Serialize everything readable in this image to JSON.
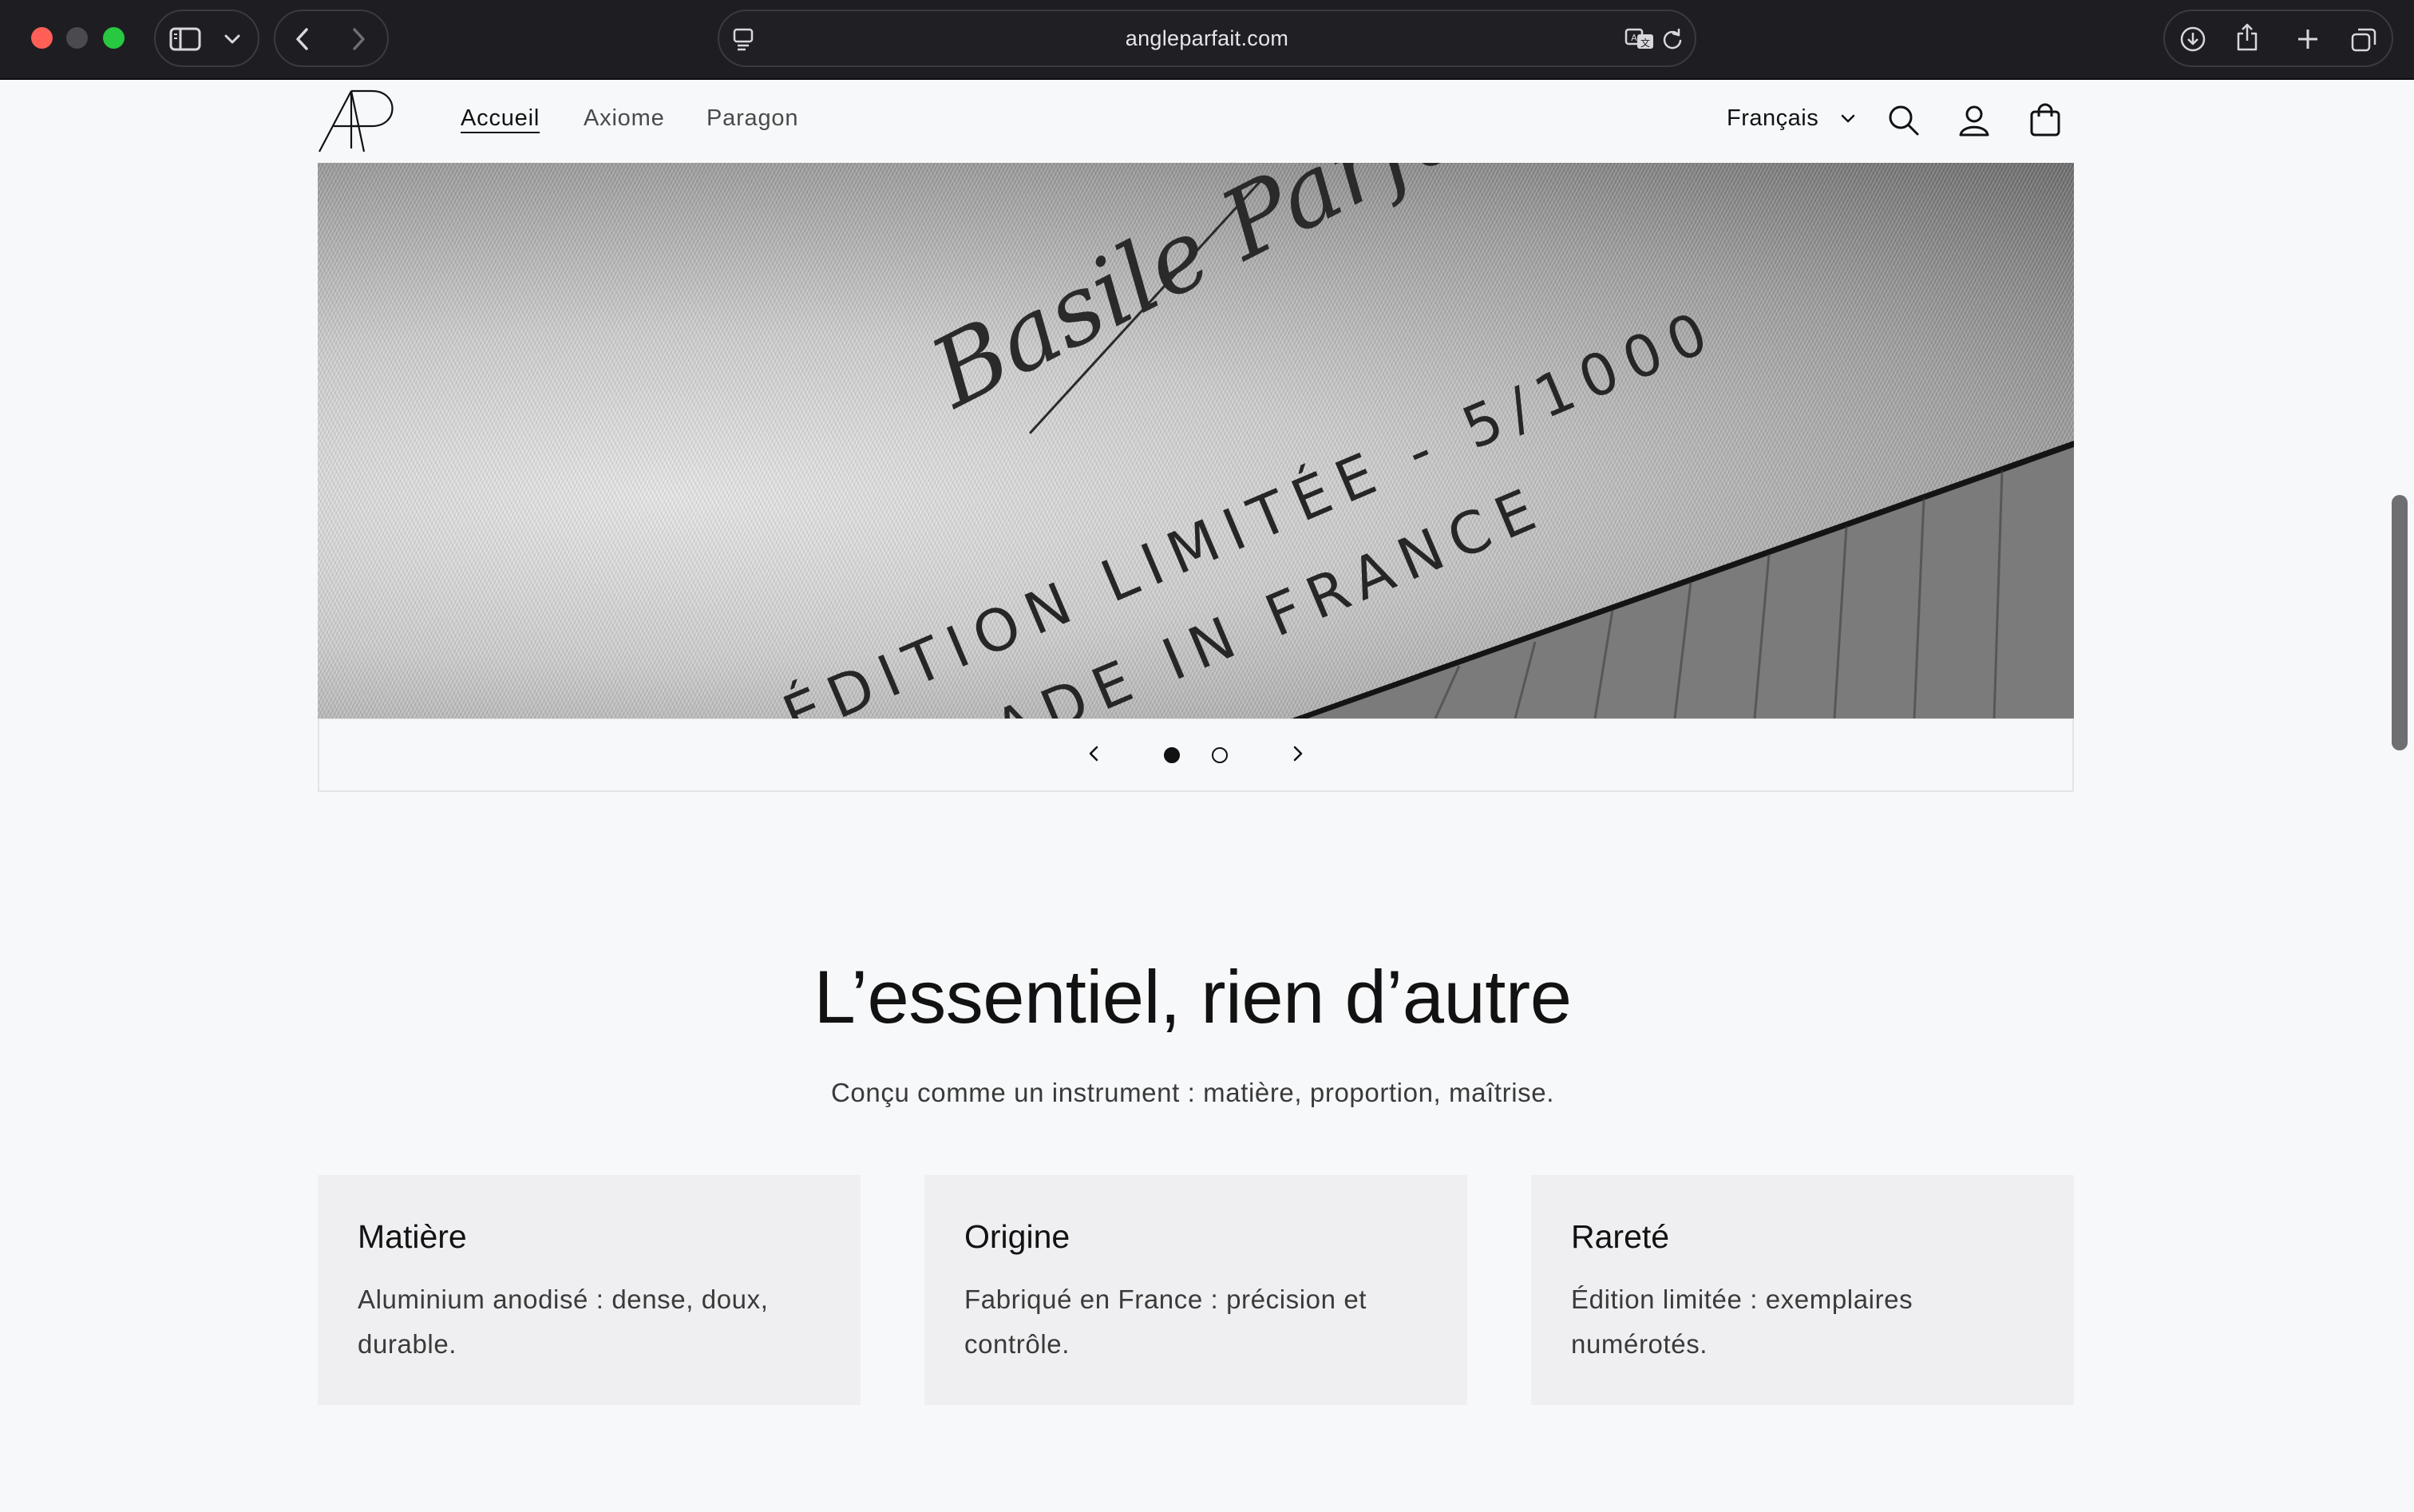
{
  "browser": {
    "url": "angleparfait.com",
    "icons": {
      "sidebar": "sidebar-icon",
      "sidebar_menu": "chevron-down-icon",
      "back": "chevron-left-icon",
      "forward": "chevron-right-icon",
      "page_menu": "page-menu-icon",
      "translate": "translate-icon",
      "reload": "reload-icon",
      "downloads": "download-icon",
      "share": "share-icon",
      "new_tab": "plus-icon",
      "tabs": "tab-overview-icon"
    }
  },
  "header": {
    "logo_text": "AP",
    "nav": [
      {
        "label": "Accueil",
        "active": true
      },
      {
        "label": "Axiome",
        "active": false
      },
      {
        "label": "Paragon",
        "active": false
      }
    ],
    "language": "Français",
    "icons": {
      "search": "search-icon",
      "account": "account-icon",
      "cart": "cart-icon"
    }
  },
  "hero": {
    "engraving_line1": "ÉDITION LIMITÉE - 5/1000",
    "engraving_line2": "MADE IN FRANCE",
    "signature": "Basile Parfait",
    "slide_count": 2,
    "active_slide": 1
  },
  "intro": {
    "title": "L’essentiel, rien d’autre",
    "subtitle": "Conçu comme un instrument : matière, proportion, maîtrise."
  },
  "features": [
    {
      "title": "Matière",
      "text": "Aluminium anodisé : dense, doux, durable."
    },
    {
      "title": "Origine",
      "text": "Fabriqué en France : précision et contrôle."
    },
    {
      "title": "Rareté",
      "text": "Édition limitée : exemplaires numérotés."
    }
  ],
  "colors": {
    "chrome_bg": "#1e1e22",
    "page_bg": "#f7f8fa",
    "card_bg": "#efeff1",
    "text": "#121212",
    "close": "#ff5f57",
    "maximize": "#28c840"
  }
}
